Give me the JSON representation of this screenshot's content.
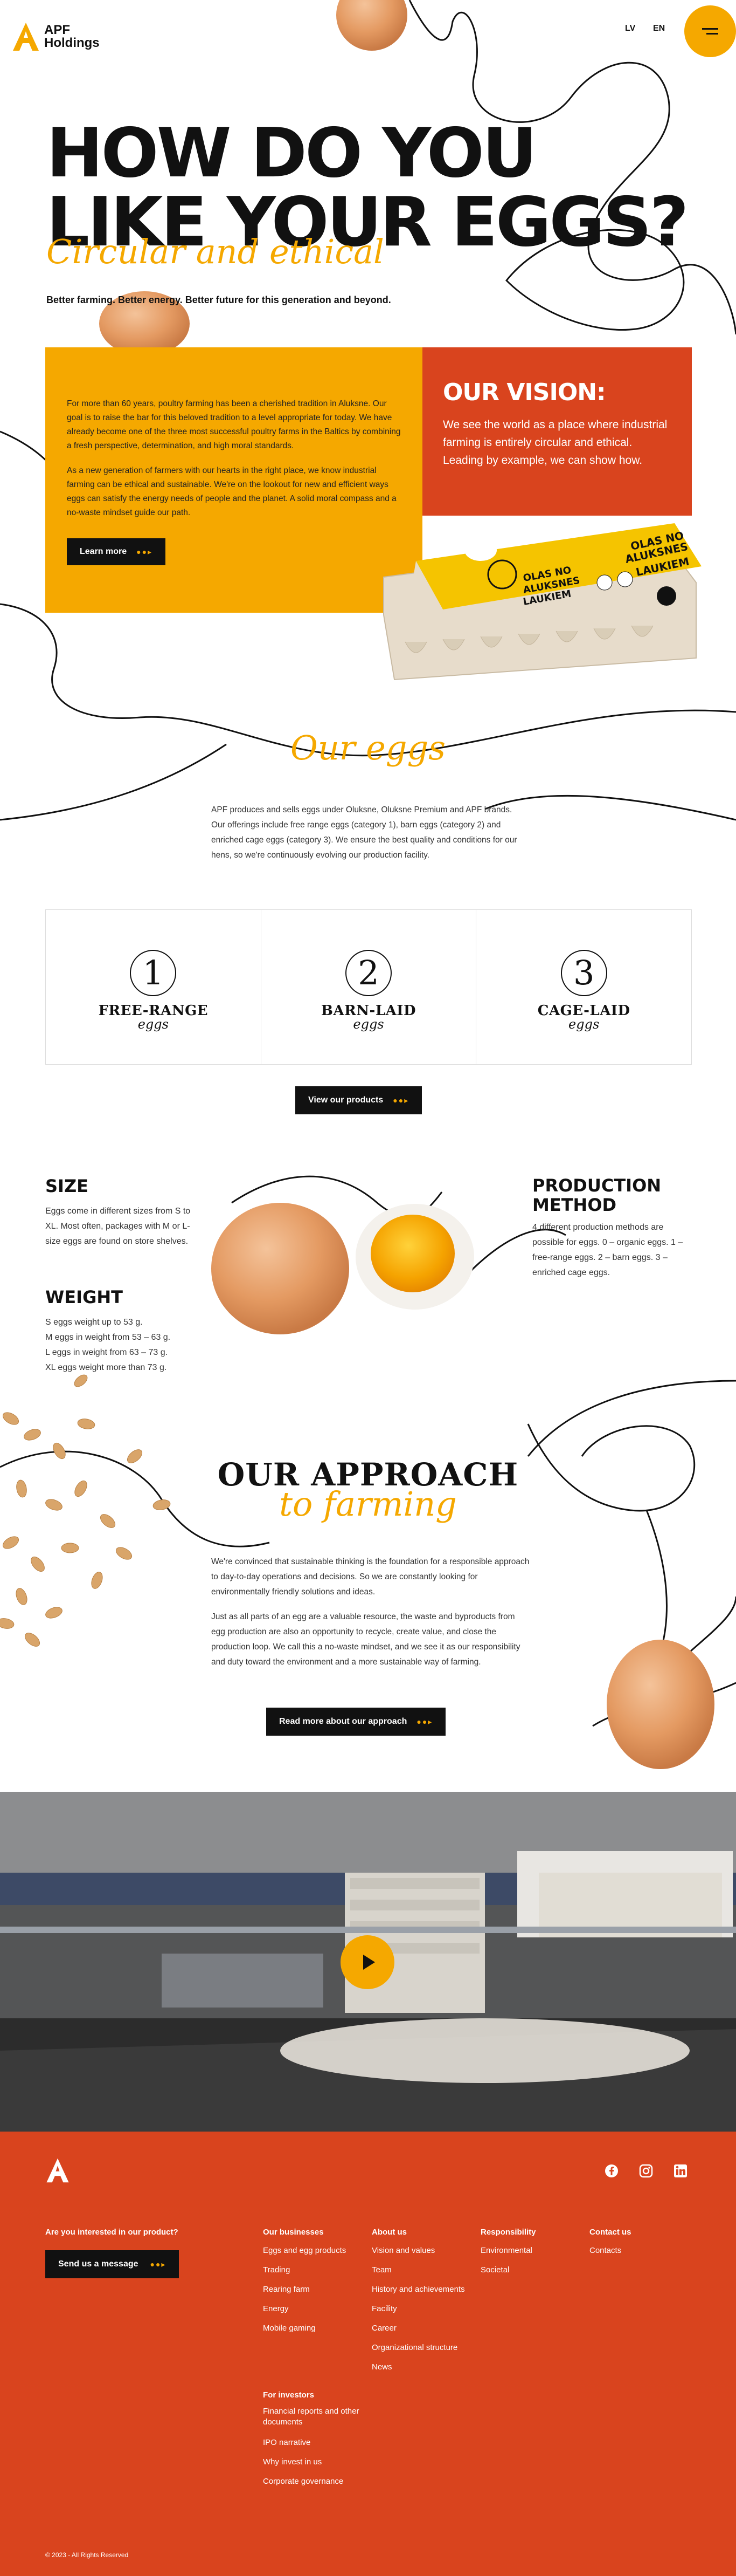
{
  "header": {
    "logo_line1": "APF",
    "logo_line2": "Holdings",
    "lang_lv": "LV",
    "lang_en": "EN"
  },
  "hero": {
    "title_line1": "HOW DO YOU",
    "title_line2": "LIKE YOUR EGGS?",
    "script": "Circular and ethical",
    "subtitle": "Better farming. Better energy. Better future for this generation and beyond."
  },
  "intro": {
    "p1": "For more than 60 years, poultry farming has been a cherished tradition in Aluksne. Our goal is to raise the bar for this beloved tradition to a level appropriate for today. We have already become one of the three most successful poultry farms in the Baltics by combining a fresh perspective, determination, and high moral standards.",
    "p2": "As a new generation of farmers with our hearts in the right place, we know industrial farming can be ethical and sustainable. We're on the lookout for new and efficient ways eggs can satisfy the energy needs of people and the planet. A solid moral compass and a no-waste mindset guide our path.",
    "button": "Learn more"
  },
  "vision": {
    "title": "OUR VISION:",
    "text": "We see the world as a place where industrial farming is entirely circular and ethical. Leading by example, we can show how."
  },
  "carton": {
    "brand_line1": "OLAS NO",
    "brand_line2": "ALUKSNES",
    "brand_line3": "LAUKIEM"
  },
  "eggs": {
    "title": "Our eggs",
    "text": "APF produces and sells eggs under Oluksne, Oluksne Premium and APF brands. Our offerings include free range eggs (category 1), barn eggs (category 2) and enriched cage eggs (category 3). We ensure the best quality and conditions for our hens, so we're continuously evolving our production facility.",
    "cards": [
      {
        "num": "1",
        "title": "FREE-RANGE",
        "sub": "eggs"
      },
      {
        "num": "2",
        "title": "BARN-LAID",
        "sub": "eggs"
      },
      {
        "num": "3",
        "title": "CAGE-LAID",
        "sub": "eggs"
      }
    ],
    "button": "View our products"
  },
  "size": {
    "title": "SIZE",
    "text": "Eggs come in different sizes from S to XL. Most often, packages with M or L-size eggs are found on store shelves."
  },
  "weight": {
    "title": "WEIGHT",
    "lines": [
      "S eggs weight up to 53 g.",
      "M eggs in weight from 53 – 63 g.",
      "L eggs in weight from 63 – 73 g.",
      "XL eggs weight more than 73 g."
    ]
  },
  "production": {
    "title_line1": "PRODUCTION",
    "title_line2": "METHOD",
    "text": "4 different production methods are possible for eggs. 0 – organic eggs. 1 – free-range eggs. 2 – barn eggs. 3 – enriched cage eggs."
  },
  "approach": {
    "title": "OUR APPROACH",
    "script": "to farming",
    "p1": "We're convinced that sustainable thinking is the foundation for a responsible approach to day-to-day operations and decisions. So we are constantly looking for environmentally friendly solutions and ideas.",
    "p2": "Just as all parts of an egg are a valuable resource, the waste and byproducts from egg production are also an opportunity to recycle, create value, and close the production loop. We call this a no-waste mindset, and we see it as our responsibility and duty toward the environment and a more sustainable way of farming.",
    "button": "Read more about our approach"
  },
  "footer": {
    "cta_question": "Are you interested in our product?",
    "cta_button": "Send us a message",
    "columns": [
      {
        "title": "Our businesses",
        "links": [
          "Eggs and egg products",
          "Trading",
          "Rearing farm",
          "Energy",
          "Mobile gaming"
        ]
      },
      {
        "title": "About us",
        "links": [
          "Vision and values",
          "Team",
          "History and achievements",
          "Facility",
          "Career",
          "Organizational structure",
          "News"
        ]
      },
      {
        "title": "Responsibility",
        "links": [
          "Environmental",
          "Societal"
        ]
      },
      {
        "title": "Contact us",
        "links": [
          "Contacts"
        ]
      }
    ],
    "investors": {
      "title": "For investors",
      "links": [
        "Financial reports and other documents",
        "IPO narrative",
        "Why invest in us",
        "Corporate governance"
      ]
    },
    "copyright": "© 2023 - All Rights Reserved",
    "social": [
      "facebook-icon",
      "instagram-icon",
      "linkedin-icon"
    ]
  },
  "colors": {
    "accent": "#f5a800",
    "brand_red": "#d9441e",
    "dark": "#111111"
  }
}
